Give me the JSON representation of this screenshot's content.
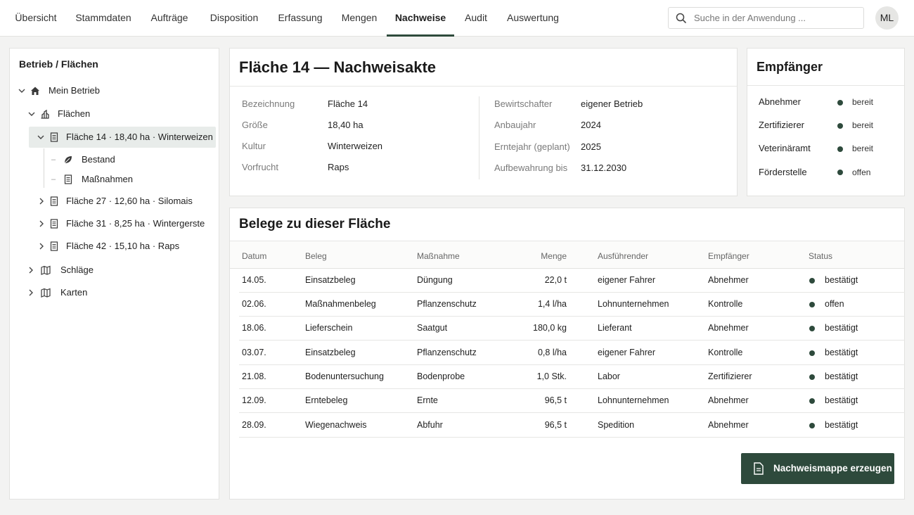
{
  "nav": {
    "tabs": [
      {
        "label": "Übersicht",
        "active": false
      },
      {
        "label": "Stammdaten",
        "active": false
      },
      {
        "label": "Aufträge",
        "active": false
      },
      {
        "label": "Disposition",
        "active": false
      },
      {
        "label": "Erfassung",
        "active": false
      },
      {
        "label": "Mengen",
        "active": false
      },
      {
        "label": "Nachweise",
        "active": true
      },
      {
        "label": "Audit",
        "active": false
      },
      {
        "label": "Auswertung",
        "active": false
      }
    ],
    "search_placeholder": "Suche in der Anwendung ...",
    "avatar_initials": "ML"
  },
  "tree": {
    "title": "Betrieb / Flächen",
    "root": "Mein Betrieb",
    "flaechen": "Flächen",
    "selected_field": "Fläche 14 · 18,40 ha · Winterweizen",
    "bestand": "Bestand",
    "massnahmen": "Maßnahmen",
    "fields": [
      "Fläche 27 · 12,60 ha · Silomais",
      "Fläche 31 · 8,25 ha · Wintergerste",
      "Fläche 42 · 15,10 ha · Raps"
    ],
    "schlaege": "Schläge",
    "karten": "Karten"
  },
  "akte": {
    "title": "Fläche 14 — Nachweisakte",
    "left": [
      {
        "key": "Bezeichnung",
        "value": "Fläche 14"
      },
      {
        "key": "Größe",
        "value": "18,40 ha"
      },
      {
        "key": "Kultur",
        "value": "Winterweizen"
      },
      {
        "key": "Vorfrucht",
        "value": "Raps"
      }
    ],
    "right": [
      {
        "key": "Bewirtschafter",
        "value": "eigener Betrieb"
      },
      {
        "key": "Anbaujahr",
        "value": "2024"
      },
      {
        "key": "Erntejahr (geplant)",
        "value": "2025"
      },
      {
        "key": "Aufbewahrung bis",
        "value": "31.12.2030"
      }
    ]
  },
  "empfaenger": {
    "title": "Empfänger",
    "items": [
      {
        "name": "Abnehmer",
        "status": "bereit"
      },
      {
        "name": "Zertifizierer",
        "status": "bereit"
      },
      {
        "name": "Veterinäramt",
        "status": "bereit"
      },
      {
        "name": "Förderstelle",
        "status": "offen"
      }
    ]
  },
  "belege": {
    "title": "Belege zu dieser Fläche",
    "columns": [
      "Datum",
      "Beleg",
      "Maßnahme",
      "Menge",
      "Ausführender",
      "Empfänger",
      "Status"
    ],
    "rows": [
      {
        "datum": "14.05.",
        "beleg": "Einsatzbeleg",
        "massnahme": "Düngung",
        "menge": "22,0 t",
        "ausfuehrender": "eigener Fahrer",
        "empfaenger": "Abnehmer",
        "status": "bestätigt"
      },
      {
        "datum": "02.06.",
        "beleg": "Maßnahmenbeleg",
        "massnahme": "Pflanzenschutz",
        "menge": "1,4 l/ha",
        "ausfuehrender": "Lohnunternehmen",
        "empfaenger": "Kontrolle",
        "status": "offen"
      },
      {
        "datum": "18.06.",
        "beleg": "Lieferschein",
        "massnahme": "Saatgut",
        "menge": "180,0  kg",
        "ausfuehrender": "Lieferant",
        "empfaenger": "Abnehmer",
        "status": "bestätigt"
      },
      {
        "datum": "03.07.",
        "beleg": "Einsatzbeleg",
        "massnahme": "Pflanzenschutz",
        "menge": "0,8 l/ha",
        "ausfuehrender": "eigener Fahrer",
        "empfaenger": "Kontrolle",
        "status": "bestätigt"
      },
      {
        "datum": "21.08.",
        "beleg": "Bodenuntersuchung",
        "massnahme": "Bodenprobe",
        "menge": "1,0 Stk.",
        "ausfuehrender": "Labor",
        "empfaenger": "Zertifizierer",
        "status": "bestätigt"
      },
      {
        "datum": "12.09.",
        "beleg": "Erntebeleg",
        "massnahme": "Ernte",
        "menge": "96,5 t",
        "ausfuehrender": "Lohnunternehmen",
        "empfaenger": "Abnehmer",
        "status": "bestätigt"
      },
      {
        "datum": "28.09.",
        "beleg": "Wiegenachweis",
        "massnahme": "Abfuhr",
        "menge": "96,5 t",
        "ausfuehrender": "Spedition",
        "empfaenger": "Abnehmer",
        "status": "bestätigt"
      }
    ]
  },
  "actions": {
    "create_label": "Nachweismappe erzeugen"
  },
  "colors": {
    "accent": "#2e4a3c",
    "selected_bg": "#e8ecea",
    "page_bg": "#f3f3f2"
  }
}
